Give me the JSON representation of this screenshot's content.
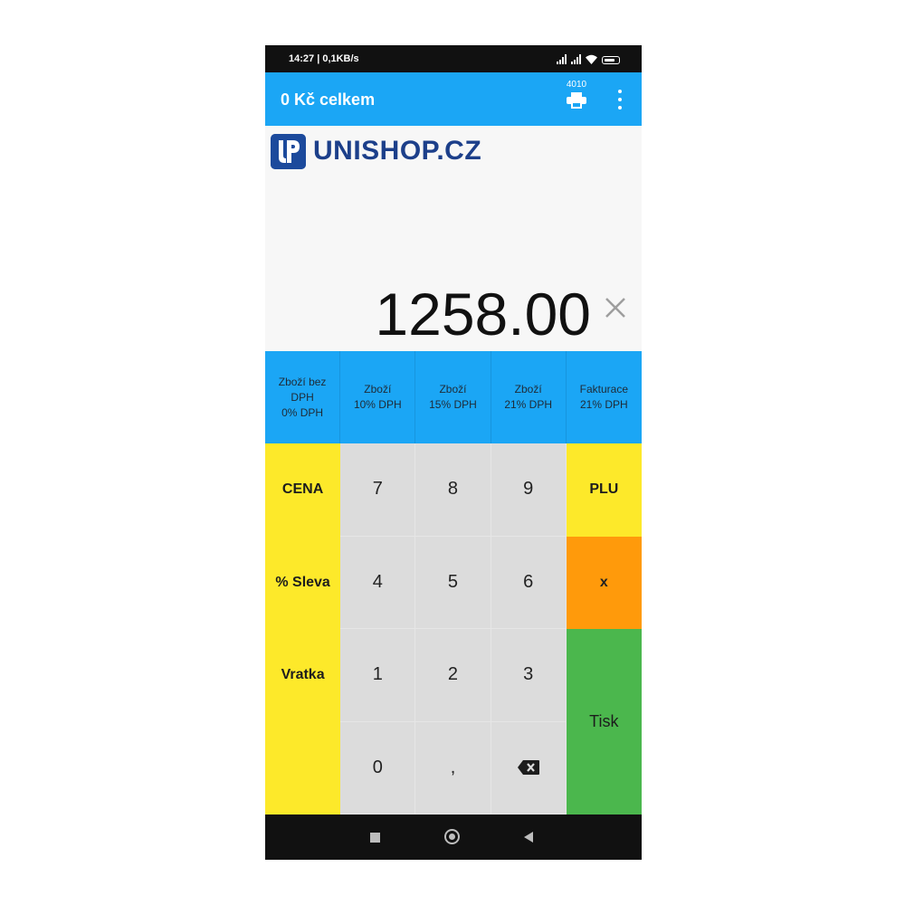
{
  "status": {
    "time": "14:27 | 0,1KB/s"
  },
  "appbar": {
    "title": "0 Kč celkem",
    "print_count": "4010",
    "print_icon": "printer-icon",
    "menu_icon": "more-vert-icon",
    "color": "#1ba6f5"
  },
  "logo": {
    "text": "UNISHOP.CZ",
    "brand_color": "#1c4a9c"
  },
  "display": {
    "amount": "1258.00",
    "clear_icon": "close-icon"
  },
  "vat_buttons": [
    "Zboží bez\nDPH\n0% DPH",
    "Zboží\n10% DPH",
    "Zboží\n15% DPH",
    "Zboží\n21% DPH",
    "Fakturace\n21% DPH"
  ],
  "keys": {
    "cena": "CENA",
    "sleva": "% Sleva",
    "vratka": "Vratka",
    "plu": "PLU",
    "times": "x",
    "tisk": "Tisk",
    "k7": "7",
    "k8": "8",
    "k9": "9",
    "k4": "4",
    "k5": "5",
    "k6": "6",
    "k1": "1",
    "k2": "2",
    "k3": "3",
    "k0": "0",
    "comma": ",",
    "backspace_icon": "backspace-icon"
  },
  "colors": {
    "yellow": "#fde92a",
    "orange": "#ff9a0b",
    "green": "#4bb74d",
    "grey": "#dcdcdc"
  },
  "nav": {
    "recents_icon": "square-icon",
    "home_icon": "circle-home-icon",
    "back_icon": "back-triangle-icon"
  }
}
